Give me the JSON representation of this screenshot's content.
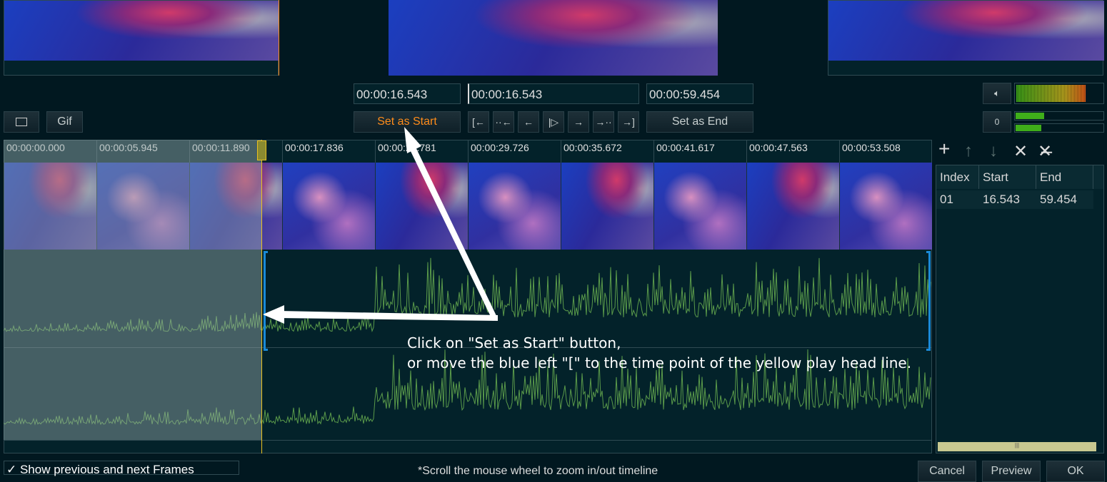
{
  "preview": {
    "positions": [
      "previous-frame",
      "current-frame",
      "next-frame"
    ]
  },
  "times": {
    "start": "00:00:16.543",
    "current": "00:00:16.543",
    "end": "00:00:59.454"
  },
  "buttons": {
    "snapshot_icon": "camera-icon",
    "gif": "Gif",
    "set_start": "Set as Start",
    "set_end": "Set as End",
    "nav": [
      "[←",
      "··←",
      "←",
      "|▷",
      "→",
      "→··",
      "→]"
    ],
    "volume_icon": "speaker-icon",
    "channel": "0"
  },
  "timeline": {
    "labels": [
      "00:00:00.000",
      "00:00:05.945",
      "00:00:11.890",
      "00:00:17.836",
      "00:00:23.781",
      "00:00:29.726",
      "00:00:35.672",
      "00:00:41.617",
      "00:00:47.563",
      "00:00:53.508"
    ]
  },
  "annotation": {
    "line1": "Click on \"Set as Start\" button,",
    "line2": "or move the blue left \"[\" to the time point of the yellow play head line."
  },
  "segments": {
    "toolbar": [
      "+",
      "↑",
      "↓",
      "✕",
      "✕̶"
    ],
    "columns": [
      "Index",
      "Start",
      "End"
    ],
    "rows": [
      {
        "index": "01",
        "start": "16.543",
        "end": "59.454"
      }
    ]
  },
  "footer": {
    "show_frames": "Show previous and next Frames",
    "hint": "*Scroll the mouse wheel to zoom in/out timeline",
    "cancel": "Cancel",
    "preview": "Preview",
    "ok": "OK"
  },
  "colors": {
    "accent": "#ff8c1a",
    "playhead": "#e8c020",
    "bracket": "#1a8ad8",
    "wave": "#5a9a4a"
  }
}
